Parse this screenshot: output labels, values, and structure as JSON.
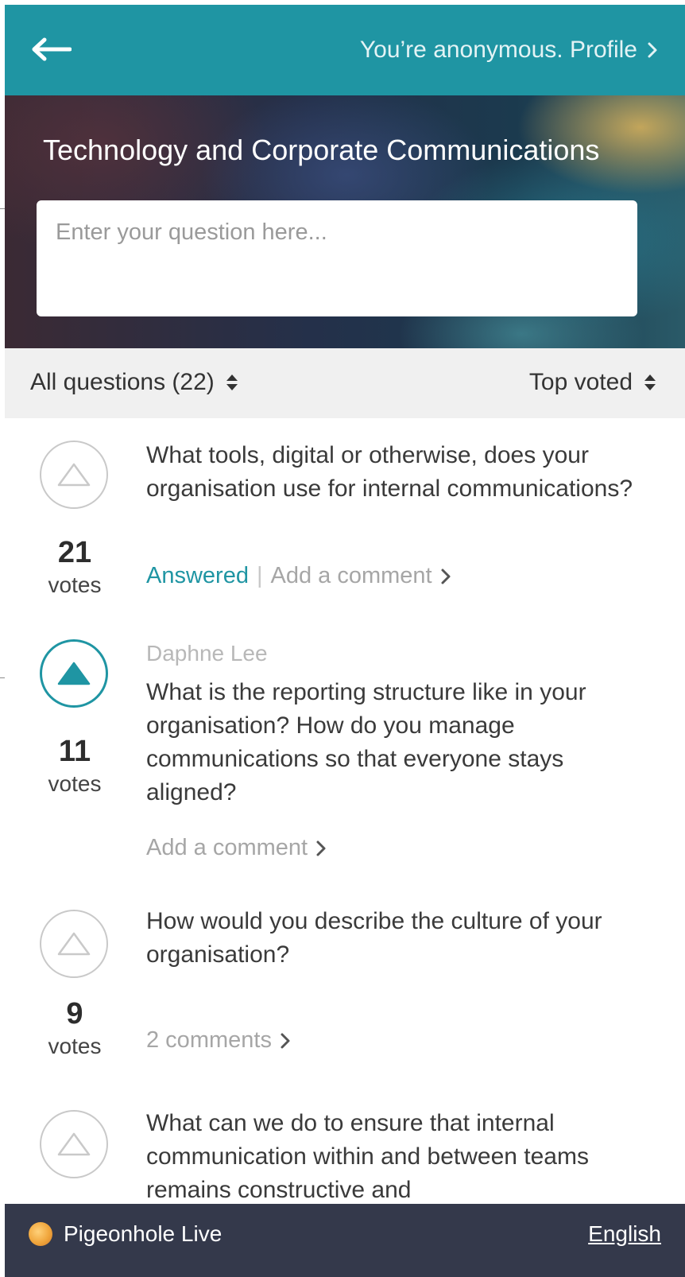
{
  "header": {
    "profile_text": "You’re anonymous. Profile"
  },
  "hero": {
    "title": "Technology and Corporate Communications",
    "input_placeholder": "Enter your question here..."
  },
  "filters": {
    "left_label": "All questions (22)",
    "right_label": "Top voted"
  },
  "questions": [
    {
      "votes": "21",
      "votes_label": "votes",
      "voted": false,
      "author": "",
      "text": "What tools, digital or otherwise, does your organisation use for internal communications?",
      "status": "Answered",
      "comment_link": "Add a comment"
    },
    {
      "votes": "11",
      "votes_label": "votes",
      "voted": true,
      "author": "Daphne Lee",
      "text": "What is the reporting structure like in your organisation? How do you manage communications so that everyone stays aligned?",
      "status": "",
      "comment_link": "Add a comment"
    },
    {
      "votes": "9",
      "votes_label": "votes",
      "voted": false,
      "author": "",
      "text": "How would you describe the culture of your organisation?",
      "status": "",
      "comment_link": "2 comments"
    },
    {
      "votes": "",
      "votes_label": "",
      "voted": false,
      "author": "",
      "text": "What can we do to ensure that internal communication within and between teams remains constructive and",
      "status": "",
      "comment_link": ""
    }
  ],
  "footer": {
    "brand": "Pigeonhole Live",
    "language": "English"
  },
  "colors": {
    "accent": "#1f95a3",
    "footer_bg": "#34394b",
    "filter_bg": "#f0f0f0"
  },
  "icons": {
    "back": "arrow-left-icon",
    "chevron": "chevron-right-icon",
    "sort": "sort-updown-icon",
    "upvote": "triangle-up-icon",
    "logo": "pigeonhole-logo-icon"
  }
}
